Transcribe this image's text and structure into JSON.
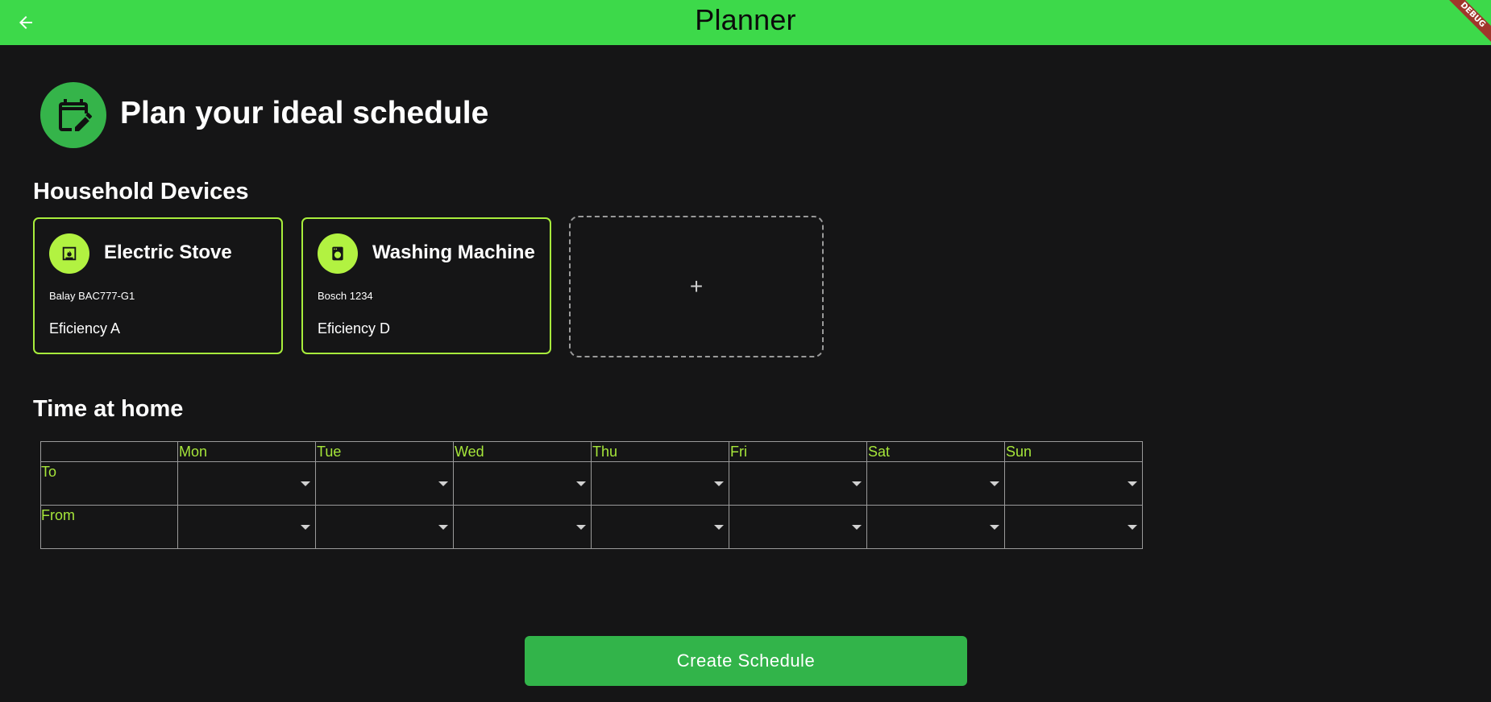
{
  "appbar": {
    "title": "Planner",
    "color": "#3dd94a",
    "back_icon": "arrow-back-icon",
    "debug_label": "DEBUG"
  },
  "hero": {
    "icon": "calendar-edit-icon",
    "title": "Plan your ideal schedule"
  },
  "devices_section": {
    "title": "Household Devices",
    "devices": [
      {
        "name": "Electric Stove",
        "model": "Balay BAC777-G1",
        "efficiency": "Eficiency A",
        "icon": "fireplace-icon"
      },
      {
        "name": "Washing Machine",
        "model": "Bosch 1234",
        "efficiency": "Eficiency D",
        "icon": "washing-machine-icon"
      }
    ],
    "add_label": "+"
  },
  "time_section": {
    "title": "Time at home",
    "days": [
      "Mon",
      "Tue",
      "Wed",
      "Thu",
      "Fri",
      "Sat",
      "Sun"
    ],
    "rows": [
      "To",
      "From"
    ]
  },
  "create_button": {
    "label": "Create Schedule"
  },
  "colors": {
    "background": "#151516",
    "accent": "#a8ee3c",
    "button": "#32b44a"
  }
}
